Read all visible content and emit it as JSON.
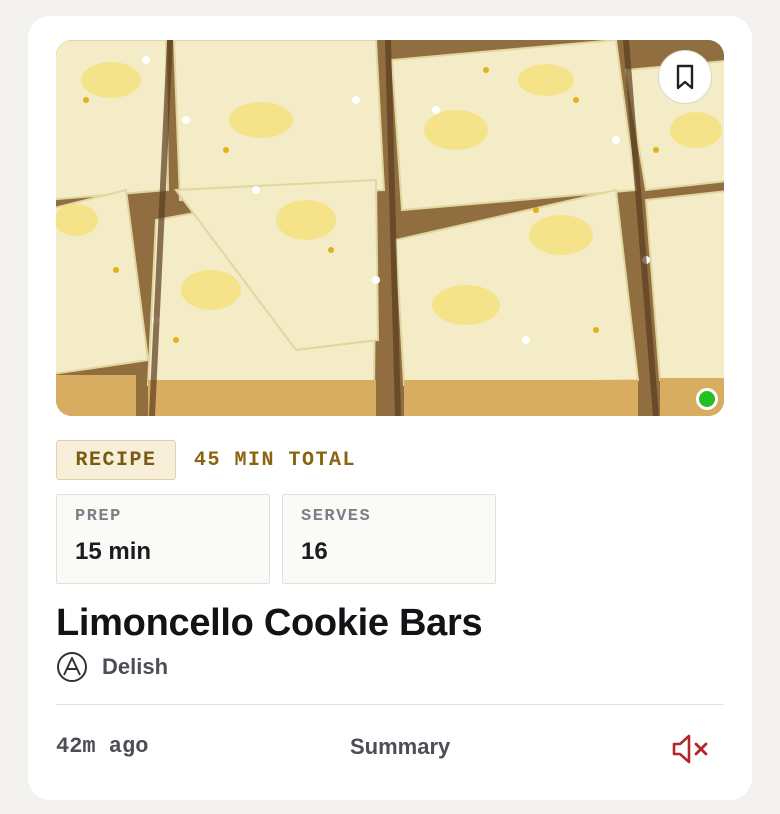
{
  "card": {
    "tag_label": "RECIPE",
    "total_time": "45 MIN TOTAL",
    "stats": [
      {
        "label": "PREP",
        "value": "15 min"
      },
      {
        "label": "SERVES",
        "value": "16"
      }
    ],
    "title": "Limoncello Cookie Bars",
    "source": "Delish",
    "posted": "42m ago",
    "summary_label": "Summary"
  },
  "icons": {
    "bookmark": "bookmark-icon",
    "source_logo": "delish-logo-icon",
    "mute": "speaker-muted-icon",
    "status": "online-status-dot"
  },
  "colors": {
    "card_bg": "#ffffff",
    "page_bg": "#f3f2ee",
    "tag_bg": "#f7efd9",
    "tag_text": "#7a5a12",
    "mute_icon": "#b3262b",
    "status_dot": "#22c022"
  }
}
